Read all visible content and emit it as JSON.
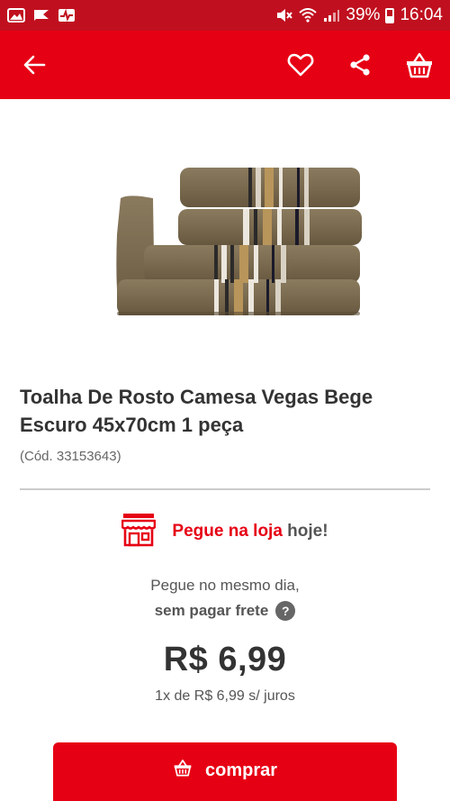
{
  "status_bar": {
    "battery": "39%",
    "time": "16:04"
  },
  "colors": {
    "status_bar": "#c0101f",
    "app_bar": "#e60014",
    "accent": "#e60014"
  },
  "app_bar": {
    "icons": [
      "back-arrow-icon",
      "heart-icon",
      "share-icon",
      "basket-icon"
    ]
  },
  "product": {
    "title": "Toalha De Rosto Camesa Vegas Bege Escuro 45x70cm 1 peça",
    "code": "(Cód. 33153643)"
  },
  "pickup": {
    "highlight": "Pegue na loja",
    "suffix": " hoje!",
    "line1": "Pegue no mesmo dia,",
    "line2": "sem pagar frete"
  },
  "price": {
    "value": "R$ 6,99",
    "installments": "1x de R$ 6,99 s/ juros"
  },
  "buy_button": {
    "label": "comprar"
  }
}
